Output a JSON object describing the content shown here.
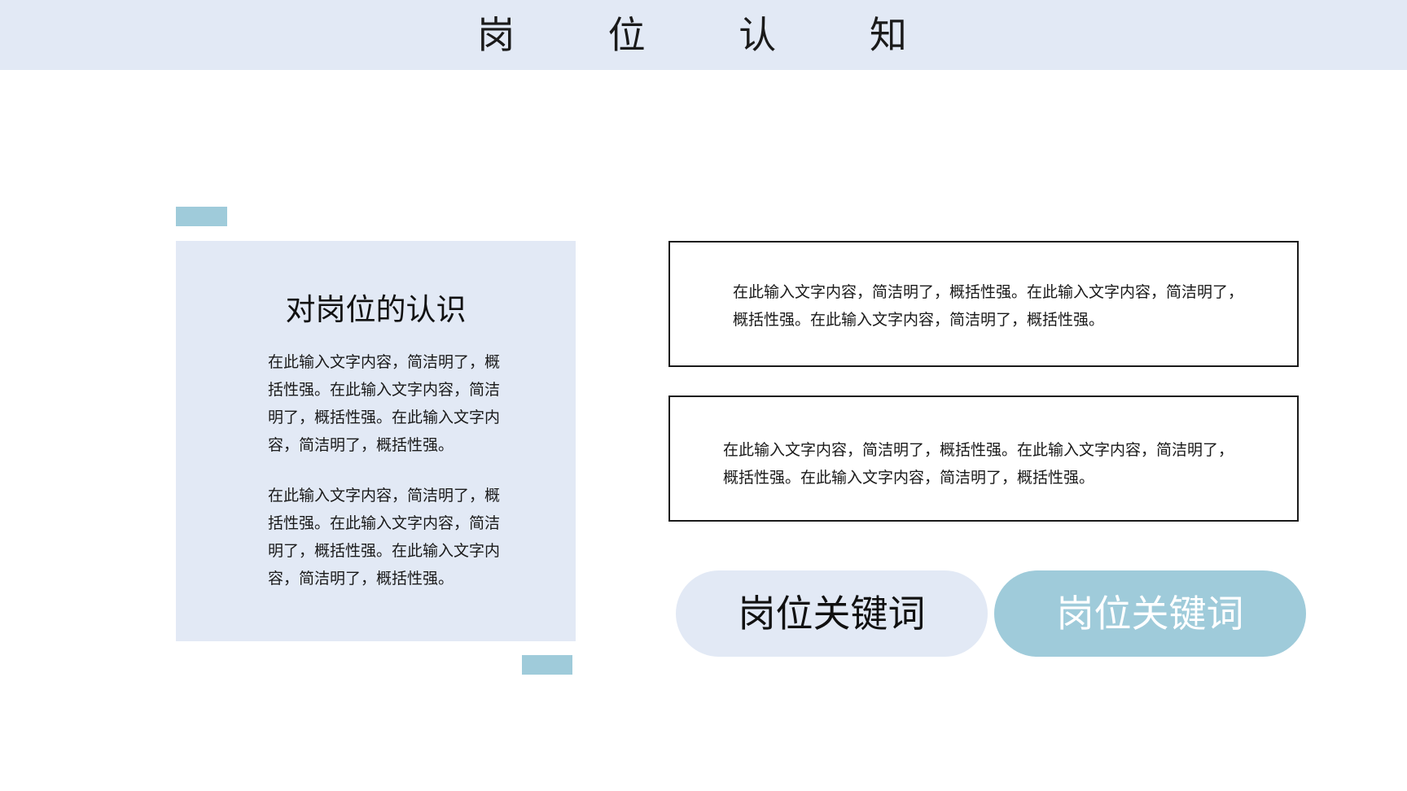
{
  "header": {
    "title": "岗 位 认 知"
  },
  "left_panel": {
    "title": "对岗位的认识",
    "paragraph_1": "在此输入文字内容，简洁明了，概括性强。在此输入文字内容，简洁明了，概括性强。在此输入文字内容，简洁明了，概括性强。",
    "paragraph_2": "在此输入文字内容，简洁明了，概括性强。在此输入文字内容，简洁明了，概括性强。在此输入文字内容，简洁明了，概括性强。"
  },
  "boxes": [
    {
      "text": "在此输入文字内容，简洁明了，概括性强。在此输入文字内容，简洁明了，概括性强。在此输入文字内容，简洁明了，概括性强。"
    },
    {
      "text": "在此输入文字内容，简洁明了，概括性强。在此输入文字内容，简洁明了，概括性强。在此输入文字内容，简洁明了，概括性强。"
    }
  ],
  "keywords": [
    {
      "label": "岗位关键词"
    },
    {
      "label": "岗位关键词"
    }
  ],
  "colors": {
    "light_blue": "#e2e9f5",
    "accent_blue": "#9fcbda"
  }
}
